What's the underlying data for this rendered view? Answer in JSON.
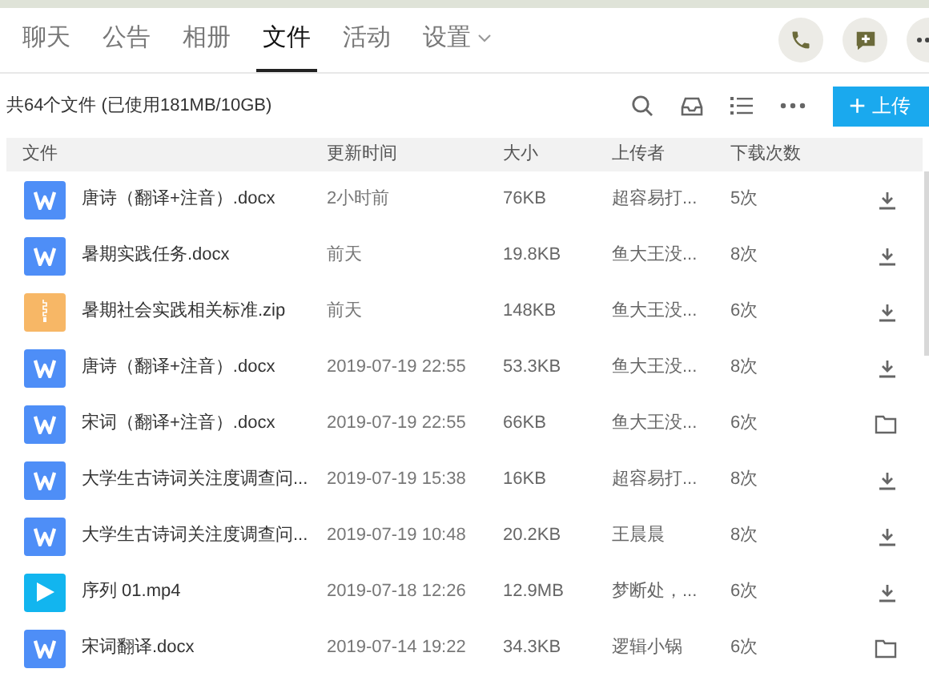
{
  "tabs": [
    {
      "label": "聊天",
      "selected": false
    },
    {
      "label": "公告",
      "selected": false
    },
    {
      "label": "相册",
      "selected": false
    },
    {
      "label": "文件",
      "selected": true
    },
    {
      "label": "活动",
      "selected": false
    },
    {
      "label": "设置",
      "selected": false,
      "dropdown": true
    }
  ],
  "summary": "共64个文件 (已使用181MB/10GB)",
  "upload_button": {
    "icon": "+",
    "label": "上传"
  },
  "columns": [
    "文件",
    "更新时间",
    "大小",
    "上传者",
    "下载次数"
  ],
  "rows": [
    {
      "kind": "word",
      "name": "唐诗（翻译+注音）.docx",
      "time": "2小时前",
      "size": "76KB",
      "uploader": "超容易打...",
      "downloads": "5次",
      "action": {
        "kind": "download"
      }
    },
    {
      "kind": "word",
      "name": "暑期实践任务.docx",
      "time": "前天",
      "size": "19.8KB",
      "uploader": "鱼大王没...",
      "downloads": "8次",
      "action": {
        "kind": "download"
      }
    },
    {
      "kind": "zip",
      "name": "暑期社会实践相关标准.zip",
      "time": "前天",
      "size": "148KB",
      "uploader": "鱼大王没...",
      "downloads": "6次",
      "action": {
        "kind": "download"
      }
    },
    {
      "kind": "word",
      "name": "唐诗（翻译+注音）.docx",
      "time": "2019-07-19 22:55",
      "size": "53.3KB",
      "uploader": "鱼大王没...",
      "downloads": "8次",
      "action": {
        "kind": "download"
      }
    },
    {
      "kind": "word",
      "name": "宋词（翻译+注音）.docx",
      "time": "2019-07-19 22:55",
      "size": "66KB",
      "uploader": "鱼大王没...",
      "downloads": "6次",
      "action": {
        "kind": "folder"
      }
    },
    {
      "kind": "word",
      "name": "大学生古诗词关注度调查问...",
      "time": "2019-07-19 15:38",
      "size": "16KB",
      "uploader": "超容易打...",
      "downloads": "8次",
      "action": {
        "kind": "download"
      }
    },
    {
      "kind": "word",
      "name": "大学生古诗词关注度调查问...",
      "time": "2019-07-19 10:48",
      "size": "20.2KB",
      "uploader": "王晨晨",
      "downloads": "8次",
      "action": {
        "kind": "download"
      }
    },
    {
      "kind": "video",
      "name": "序列 01.mp4",
      "time": "2019-07-18 12:26",
      "size": "12.9MB",
      "uploader": "梦断处，...",
      "downloads": "6次",
      "action": {
        "kind": "download"
      }
    },
    {
      "kind": "word",
      "name": "宋词翻译.docx",
      "time": "2019-07-14 19:22",
      "size": "34.3KB",
      "uploader": "逻辑小锅",
      "downloads": "6次",
      "action": {
        "kind": "folder"
      }
    }
  ]
}
